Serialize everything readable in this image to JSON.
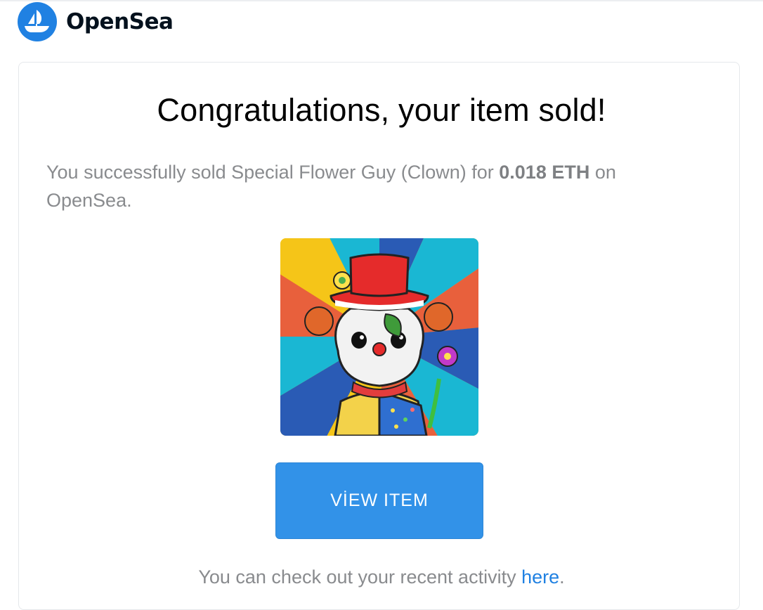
{
  "brand": {
    "name": "OpenSea",
    "logo_icon": "opensea-sailboat-icon",
    "logo_color": "#2081e2"
  },
  "email": {
    "headline": "Congratulations, your item sold!",
    "message_prefix": "You successfully sold Special Flower Guy (Clown) for ",
    "price": "0.018 ETH",
    "message_suffix": " on OpenSea.",
    "image_alt": "Special Flower Guy (Clown)",
    "button_label": "VİEW ITEM",
    "footer_prefix": "You can check out your recent activity ",
    "footer_link": "here",
    "footer_suffix": "."
  },
  "colors": {
    "button": "#3292e8",
    "link": "#2081e2",
    "body_text": "#898b8e"
  }
}
